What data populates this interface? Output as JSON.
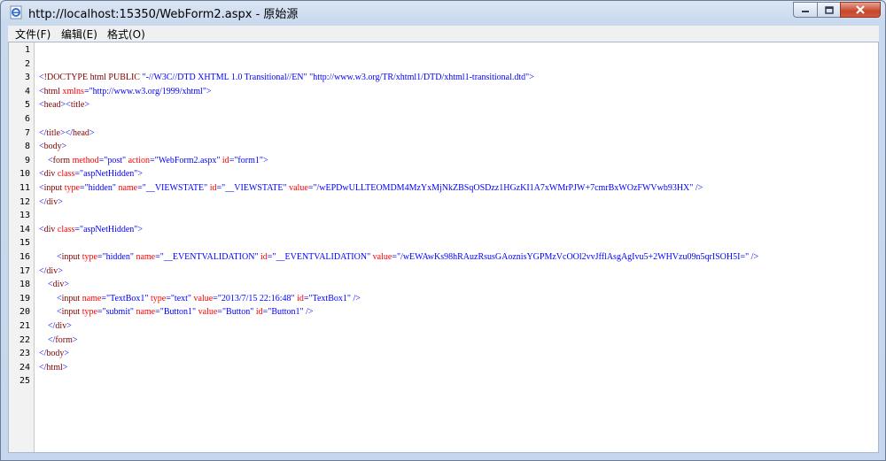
{
  "window": {
    "title": "http://localhost:15350/WebForm2.aspx - 原始源"
  },
  "menu": [
    {
      "label": "文件(F)"
    },
    {
      "label": "编辑(E)"
    },
    {
      "label": "格式(O)"
    }
  ],
  "colors": {
    "tag": "#800000",
    "attribute": "#ff0000",
    "value": "#0000ff",
    "punctuation": "#0000ff"
  },
  "source_lines": [
    {
      "n": "1",
      "tokens": []
    },
    {
      "n": "2",
      "tokens": []
    },
    {
      "n": "3",
      "tokens": [
        {
          "t": "p",
          "v": "<"
        },
        {
          "t": "tag",
          "v": "!DOCTYPE html PUBLIC"
        },
        {
          "t": "val",
          "v": " \"-//W3C//DTD XHTML 1.0 Transitional//EN\" \"http://www.w3.org/TR/xhtml1/DTD/xhtml1-transitional.dtd\""
        },
        {
          "t": "p",
          "v": ">"
        }
      ]
    },
    {
      "n": "4",
      "tokens": [
        {
          "t": "p",
          "v": "<"
        },
        {
          "t": "tag",
          "v": "html"
        },
        {
          "t": "attr",
          "v": " xmlns"
        },
        {
          "t": "p",
          "v": "="
        },
        {
          "t": "val",
          "v": "\"http://www.w3.org/1999/xhtml\""
        },
        {
          "t": "p",
          "v": ">"
        }
      ]
    },
    {
      "n": "5",
      "tokens": [
        {
          "t": "p",
          "v": "<"
        },
        {
          "t": "tag",
          "v": "head"
        },
        {
          "t": "p",
          "v": "><"
        },
        {
          "t": "tag",
          "v": "title"
        },
        {
          "t": "p",
          "v": ">"
        }
      ]
    },
    {
      "n": "6",
      "tokens": []
    },
    {
      "n": "7",
      "tokens": [
        {
          "t": "p",
          "v": "</"
        },
        {
          "t": "tag",
          "v": "title"
        },
        {
          "t": "p",
          "v": "></"
        },
        {
          "t": "tag",
          "v": "head"
        },
        {
          "t": "p",
          "v": ">"
        }
      ]
    },
    {
      "n": "8",
      "tokens": [
        {
          "t": "p",
          "v": "<"
        },
        {
          "t": "tag",
          "v": "body"
        },
        {
          "t": "p",
          "v": ">"
        }
      ]
    },
    {
      "n": "9",
      "tokens": [
        {
          "t": "p",
          "v": "    <"
        },
        {
          "t": "tag",
          "v": "form"
        },
        {
          "t": "attr",
          "v": " method"
        },
        {
          "t": "p",
          "v": "="
        },
        {
          "t": "val",
          "v": "\"post\""
        },
        {
          "t": "attr",
          "v": " action"
        },
        {
          "t": "p",
          "v": "="
        },
        {
          "t": "val",
          "v": "\"WebForm2.aspx\""
        },
        {
          "t": "attr",
          "v": " id"
        },
        {
          "t": "p",
          "v": "="
        },
        {
          "t": "val",
          "v": "\"form1\""
        },
        {
          "t": "p",
          "v": ">"
        }
      ]
    },
    {
      "n": "10",
      "tokens": [
        {
          "t": "p",
          "v": "<"
        },
        {
          "t": "tag",
          "v": "div"
        },
        {
          "t": "attr",
          "v": " class"
        },
        {
          "t": "p",
          "v": "="
        },
        {
          "t": "val",
          "v": "\"aspNetHidden\""
        },
        {
          "t": "p",
          "v": ">"
        }
      ]
    },
    {
      "n": "11",
      "tokens": [
        {
          "t": "p",
          "v": "<"
        },
        {
          "t": "tag",
          "v": "input"
        },
        {
          "t": "attr",
          "v": " type"
        },
        {
          "t": "p",
          "v": "="
        },
        {
          "t": "val",
          "v": "\"hidden\""
        },
        {
          "t": "attr",
          "v": " name"
        },
        {
          "t": "p",
          "v": "="
        },
        {
          "t": "val",
          "v": "\"__VIEWSTATE\""
        },
        {
          "t": "attr",
          "v": " id"
        },
        {
          "t": "p",
          "v": "="
        },
        {
          "t": "val",
          "v": "\"__VIEWSTATE\""
        },
        {
          "t": "attr",
          "v": " value"
        },
        {
          "t": "p",
          "v": "="
        },
        {
          "t": "val",
          "v": "\"/wEPDwULLTEOMDM4MzYxMjNkZBSqOSDzz1HGzKI1A7xWMrPJW+7cmrBxWOzFWVwb93HX\""
        },
        {
          "t": "p",
          "v": " />"
        }
      ]
    },
    {
      "n": "12",
      "tokens": [
        {
          "t": "p",
          "v": "</"
        },
        {
          "t": "tag",
          "v": "div"
        },
        {
          "t": "p",
          "v": ">"
        }
      ]
    },
    {
      "n": "13",
      "tokens": []
    },
    {
      "n": "14",
      "tokens": [
        {
          "t": "p",
          "v": "<"
        },
        {
          "t": "tag",
          "v": "div"
        },
        {
          "t": "attr",
          "v": " class"
        },
        {
          "t": "p",
          "v": "="
        },
        {
          "t": "val",
          "v": "\"aspNetHidden\""
        },
        {
          "t": "p",
          "v": ">"
        }
      ]
    },
    {
      "n": "15",
      "tokens": []
    },
    {
      "n": "16",
      "tokens": [
        {
          "t": "p",
          "v": "        <"
        },
        {
          "t": "tag",
          "v": "input"
        },
        {
          "t": "attr",
          "v": " type"
        },
        {
          "t": "p",
          "v": "="
        },
        {
          "t": "val",
          "v": "\"hidden\""
        },
        {
          "t": "attr",
          "v": " name"
        },
        {
          "t": "p",
          "v": "="
        },
        {
          "t": "val",
          "v": "\"__EVENTVALIDATION\""
        },
        {
          "t": "attr",
          "v": " id"
        },
        {
          "t": "p",
          "v": "="
        },
        {
          "t": "val",
          "v": "\"__EVENTVALIDATION\""
        },
        {
          "t": "attr",
          "v": " value"
        },
        {
          "t": "p",
          "v": "="
        },
        {
          "t": "val",
          "v": "\"/wEWAwKs98hRAuzRsusGAoznisYGPMzVcOOl2vvJfflAsgAgIvu5+2WHVzu09n5qrISOH5I=\""
        },
        {
          "t": "p",
          "v": " />"
        }
      ]
    },
    {
      "n": "17",
      "tokens": [
        {
          "t": "p",
          "v": "</"
        },
        {
          "t": "tag",
          "v": "div"
        },
        {
          "t": "p",
          "v": ">"
        }
      ]
    },
    {
      "n": "18",
      "tokens": [
        {
          "t": "p",
          "v": "    <"
        },
        {
          "t": "tag",
          "v": "div"
        },
        {
          "t": "p",
          "v": ">"
        }
      ]
    },
    {
      "n": "19",
      "tokens": [
        {
          "t": "p",
          "v": "        <"
        },
        {
          "t": "tag",
          "v": "input"
        },
        {
          "t": "attr",
          "v": " name"
        },
        {
          "t": "p",
          "v": "="
        },
        {
          "t": "val",
          "v": "\"TextBox1\""
        },
        {
          "t": "attr",
          "v": " type"
        },
        {
          "t": "p",
          "v": "="
        },
        {
          "t": "val",
          "v": "\"text\""
        },
        {
          "t": "attr",
          "v": " value"
        },
        {
          "t": "p",
          "v": "="
        },
        {
          "t": "val",
          "v": "\"2013/7/15 22:16:48\""
        },
        {
          "t": "attr",
          "v": " id"
        },
        {
          "t": "p",
          "v": "="
        },
        {
          "t": "val",
          "v": "\"TextBox1\""
        },
        {
          "t": "p",
          "v": " />"
        }
      ]
    },
    {
      "n": "20",
      "tokens": [
        {
          "t": "p",
          "v": "        <"
        },
        {
          "t": "tag",
          "v": "input"
        },
        {
          "t": "attr",
          "v": " type"
        },
        {
          "t": "p",
          "v": "="
        },
        {
          "t": "val",
          "v": "\"submit\""
        },
        {
          "t": "attr",
          "v": " name"
        },
        {
          "t": "p",
          "v": "="
        },
        {
          "t": "val",
          "v": "\"Button1\""
        },
        {
          "t": "attr",
          "v": " value"
        },
        {
          "t": "p",
          "v": "="
        },
        {
          "t": "val",
          "v": "\"Button\""
        },
        {
          "t": "attr",
          "v": " id"
        },
        {
          "t": "p",
          "v": "="
        },
        {
          "t": "val",
          "v": "\"Button1\""
        },
        {
          "t": "p",
          "v": " />"
        }
      ]
    },
    {
      "n": "21",
      "tokens": [
        {
          "t": "p",
          "v": "    </"
        },
        {
          "t": "tag",
          "v": "div"
        },
        {
          "t": "p",
          "v": ">"
        }
      ]
    },
    {
      "n": "22",
      "tokens": [
        {
          "t": "p",
          "v": "    </"
        },
        {
          "t": "tag",
          "v": "form"
        },
        {
          "t": "p",
          "v": ">"
        }
      ]
    },
    {
      "n": "23",
      "tokens": [
        {
          "t": "p",
          "v": "</"
        },
        {
          "t": "tag",
          "v": "body"
        },
        {
          "t": "p",
          "v": ">"
        }
      ]
    },
    {
      "n": "24",
      "tokens": [
        {
          "t": "p",
          "v": "</"
        },
        {
          "t": "tag",
          "v": "html"
        },
        {
          "t": "p",
          "v": ">"
        }
      ]
    },
    {
      "n": "25",
      "tokens": []
    }
  ]
}
